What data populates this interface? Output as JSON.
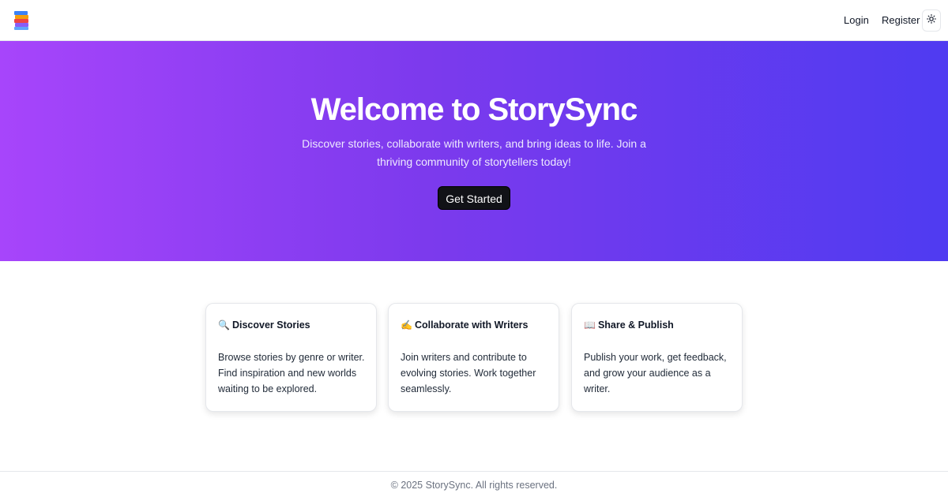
{
  "header": {
    "logo_icon": "books-stack-icon",
    "nav": {
      "login": "Login",
      "register": "Register"
    },
    "theme_toggle_icon": "sun-icon"
  },
  "hero": {
    "title": "Welcome to StorySync",
    "subtitle": "Discover stories, collaborate with writers, and bring ideas to life. Join a thriving community of storytellers today!",
    "cta_label": "Get Started",
    "gradient_colors": [
      "#a745fb",
      "#7c3aed",
      "#4f3bf1"
    ]
  },
  "features": [
    {
      "emoji": "🔍",
      "title": "Discover Stories",
      "text": "Browse stories by genre or writer. Find inspiration and new worlds waiting to be explored."
    },
    {
      "emoji": "✍️",
      "title": "Collaborate with Writers",
      "text": "Join writers and contribute to evolving stories. Work together seamlessly."
    },
    {
      "emoji": "📖",
      "title": "Share & Publish",
      "text": "Publish your work, get feedback, and grow your audience as a writer."
    }
  ],
  "footer": {
    "text": "© 2025 StorySync. All rights reserved."
  }
}
